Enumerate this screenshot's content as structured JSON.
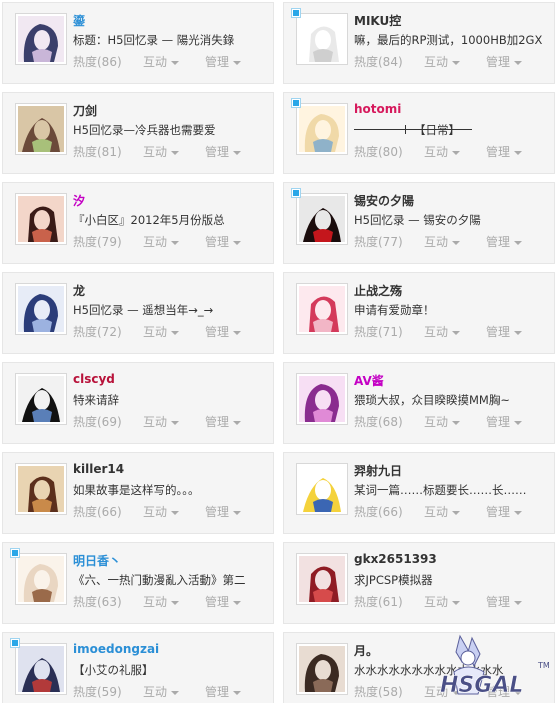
{
  "rows": [
    {
      "left": {
        "name": "鎏",
        "name_color": "#2b8fd6",
        "title": "标题：H5回忆录 — 陽光消失錄",
        "heat": "热度(86)",
        "interact": "互动",
        "manage": "管理",
        "online": false,
        "avatar_colors": [
          "#3b3f6b",
          "#c9b6d8",
          "#f1e8f2"
        ]
      },
      "right": {
        "name": "MIKU控",
        "name_color": "#333333",
        "title": "嘛，最后的RP测试，1000HB加2GX",
        "heat": "热度(84)",
        "interact": "互动",
        "manage": "管理",
        "online": true,
        "avatar_colors": [
          "#e9e9e9",
          "#cfcfcf",
          "#ffffff"
        ]
      }
    },
    {
      "left": {
        "name": "刀剑",
        "name_color": "#333333",
        "title": "H5回忆录—冷兵器也需要爱",
        "heat": "热度(81)",
        "interact": "互动",
        "manage": "管理",
        "online": false,
        "avatar_colors": [
          "#6b4a3a",
          "#a8c07a",
          "#d9c6a6"
        ]
      },
      "right": {
        "name": "hotomi",
        "name_color": "#d6195c",
        "title": "",
        "slider_suffix": "【日常】",
        "heat": "热度(80)",
        "interact": "互动",
        "manage": "管理",
        "online": true,
        "avatar_colors": [
          "#f0d9a8",
          "#8fb2c9",
          "#fff4e0"
        ]
      }
    },
    {
      "left": {
        "name": "汐",
        "name_color": "#c400c4",
        "title": "『小白区』2012年5月份版总",
        "heat": "热度(79)",
        "interact": "互动",
        "manage": "管理",
        "online": false,
        "avatar_colors": [
          "#3a1b17",
          "#c9624b",
          "#f3d6c9"
        ]
      },
      "right": {
        "name": "锡安の夕陽",
        "name_color": "#333333",
        "title": "H5回忆录 — 锡安の夕陽",
        "heat": "热度(77)",
        "interact": "互动",
        "manage": "管理",
        "online": true,
        "avatar_colors": [
          "#1a0c0c",
          "#c4161c",
          "#e8e8e8"
        ]
      }
    },
    {
      "left": {
        "name": "龙",
        "name_color": "#333333",
        "title": "H5回忆录 — 遥想当年→_→",
        "heat": "热度(72)",
        "interact": "互动",
        "manage": "管理",
        "online": false,
        "avatar_colors": [
          "#2b3d7a",
          "#9cb2e0",
          "#e7ecf7"
        ]
      },
      "right": {
        "name": "止战之殇",
        "name_color": "#333333",
        "title": "申请有爱勋章！",
        "heat": "热度(71)",
        "interact": "互动",
        "manage": "管理",
        "online": false,
        "avatar_colors": [
          "#d43a5b",
          "#f2b6c6",
          "#fde9ee"
        ]
      }
    },
    {
      "left": {
        "name": "clscyd",
        "name_color": "#b8123a",
        "title": "特来请辞",
        "heat": "热度(69)",
        "interact": "互动",
        "manage": "管理",
        "online": false,
        "avatar_colors": [
          "#111111",
          "#5a7fb8",
          "#f2f2f2"
        ]
      },
      "right": {
        "name": "AV酱",
        "name_color": "#c400c4",
        "title": "猥琐大叔，众目睽睽摸MM胸~",
        "heat": "热度(68)",
        "interact": "互动",
        "manage": "管理",
        "online": false,
        "avatar_colors": [
          "#8a2c8f",
          "#e08ad6",
          "#f7dff4"
        ]
      }
    },
    {
      "left": {
        "name": "killer14",
        "name_color": "#333333",
        "title": "如果故事是这样写的。。。",
        "heat": "热度(66)",
        "interact": "互动",
        "manage": "管理",
        "online": false,
        "avatar_colors": [
          "#5c2f1c",
          "#c98a4a",
          "#e9d4b2"
        ]
      },
      "right": {
        "name": "羿射九日",
        "name_color": "#333333",
        "title": "某词一篇……标题要长……长……",
        "heat": "热度(66)",
        "interact": "互动",
        "manage": "管理",
        "online": false,
        "avatar_colors": [
          "#f4d23c",
          "#3b66b3",
          "#ffffff"
        ]
      }
    },
    {
      "left": {
        "name": "明日香丶",
        "name_color": "#2b8fd6",
        "title": "《六、一热门動漫亂入活動》第二",
        "heat": "热度(63)",
        "interact": "互动",
        "manage": "管理",
        "online": true,
        "avatar_colors": [
          "#e9d6c2",
          "#9a6a4a",
          "#faf3ea"
        ]
      },
      "right": {
        "name": "gkx2651393",
        "name_color": "#333333",
        "title": "求JPCSP模拟器",
        "heat": "热度(61)",
        "interact": "互动",
        "manage": "管理",
        "online": false,
        "avatar_colors": [
          "#8f1c24",
          "#d64b4b",
          "#f2e1e1"
        ]
      }
    },
    {
      "left": {
        "name": "imoedongzai",
        "name_color": "#2b8fd6",
        "title": "【小艾の礼服】",
        "heat": "热度(59)",
        "interact": "互动",
        "manage": "管理",
        "online": true,
        "avatar_colors": [
          "#2a2f55",
          "#b23a3a",
          "#dfe2ef"
        ]
      },
      "right": {
        "name": "月。",
        "name_color": "#333333",
        "title": "水水水水水水水水水水水水水",
        "heat": "热度(58)",
        "interact": "互动",
        "manage": "管理",
        "online": false,
        "avatar_colors": [
          "#3b2a22",
          "#8a6a58",
          "#e8dcd2"
        ]
      }
    }
  ],
  "watermark": {
    "brand": "HSGAL",
    "tm": "TM",
    "colors": [
      "#5a5f9a",
      "#c9d0f2"
    ]
  }
}
